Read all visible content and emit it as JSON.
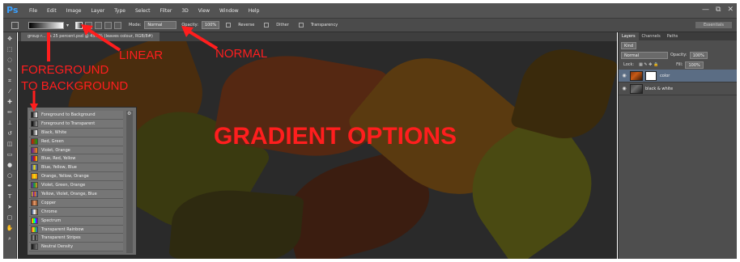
{
  "app": {
    "logo": "Ps",
    "menu": [
      "File",
      "Edit",
      "Image",
      "Layer",
      "Type",
      "Select",
      "Filter",
      "3D",
      "View",
      "Window",
      "Help"
    ],
    "window_controls": [
      "—",
      "⧉",
      "✕"
    ]
  },
  "options_bar": {
    "mode_label": "Mode:",
    "mode_value": "Normal",
    "opacity_label": "Opacity:",
    "opacity_value": "100%",
    "reverse_label": "Reverse",
    "dither_label": "Dither",
    "transparency_label": "Transparency",
    "workspace_label": "Essentials"
  },
  "document": {
    "tab_title": "group r... es 25 percent.psd @ 45.3% (leaves colour, RGB/8#)"
  },
  "gradient_presets": [
    {
      "label": "Foreground to Background",
      "colors": [
        "#000000",
        "#ffffff"
      ]
    },
    {
      "label": "Foreground to Transparent",
      "colors": [
        "#000000",
        "#9a9a9a"
      ]
    },
    {
      "label": "Black, White",
      "colors": [
        "#000000",
        "#ffffff"
      ]
    },
    {
      "label": "Red, Green",
      "colors": [
        "#d01010",
        "#10a010"
      ]
    },
    {
      "label": "Violet, Orange",
      "colors": [
        "#5a1a9a",
        "#f08a10"
      ]
    },
    {
      "label": "Blue, Red, Yellow",
      "colors": [
        "#1a3aca",
        "#d01010",
        "#f0e010"
      ]
    },
    {
      "label": "Blue, Yellow, Blue",
      "colors": [
        "#1a3aca",
        "#f0e010",
        "#1a3aca"
      ]
    },
    {
      "label": "Orange, Yellow, Orange",
      "colors": [
        "#f07a10",
        "#f0e010",
        "#f07a10"
      ]
    },
    {
      "label": "Violet, Green, Orange",
      "colors": [
        "#6a1aaa",
        "#10a040",
        "#f08a10"
      ]
    },
    {
      "label": "Yellow, Violet, Orange, Blue",
      "colors": [
        "#f0e010",
        "#6a1aaa",
        "#f07a10",
        "#1a5ada"
      ]
    },
    {
      "label": "Copper",
      "colors": [
        "#6a2a10",
        "#e8a070",
        "#8a4a20"
      ]
    },
    {
      "label": "Chrome",
      "colors": [
        "#203a6a",
        "#ffffff",
        "#6a4a2a"
      ]
    },
    {
      "label": "Spectrum",
      "colors": [
        "#ff0000",
        "#ffff00",
        "#00ff00",
        "#00ffff",
        "#0000ff",
        "#ff00ff"
      ]
    },
    {
      "label": "Transparent Rainbow",
      "colors": [
        "#ff3030",
        "#f0e010",
        "#30c030",
        "#3050ff"
      ]
    },
    {
      "label": "Transparent Stripes",
      "colors": [
        "#222222",
        "#999999",
        "#222222",
        "#999999"
      ]
    },
    {
      "label": "Neutral Density",
      "colors": [
        "#111111",
        "#777777"
      ]
    }
  ],
  "layers_panel": {
    "tabs": [
      "Layers",
      "Channels",
      "Paths"
    ],
    "kind_label": "Kind",
    "blend_mode": "Normal",
    "opacity_label": "Opacity:",
    "opacity_value": "100%",
    "lock_label": "Lock:",
    "fill_label": "Fill:",
    "fill_value": "100%",
    "layers": [
      {
        "name": "color",
        "selected": true
      },
      {
        "name": "black & white",
        "selected": false
      }
    ]
  },
  "annotations": {
    "fg_bg": "FOREGROUND",
    "fg_bg_2": "TO BACKGROUND",
    "linear": "LINEAR",
    "normal": "NORMAL",
    "title": "GRADIENT OPTIONS",
    "color": "#ff1e1e"
  }
}
